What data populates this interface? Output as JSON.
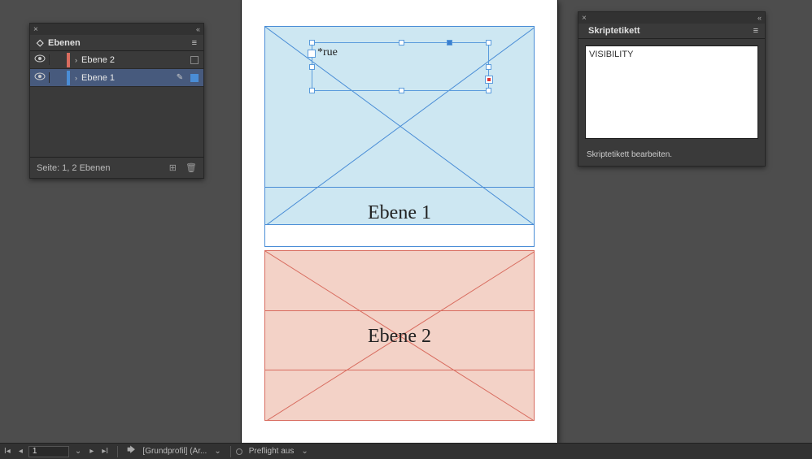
{
  "layers_panel": {
    "title": "Ebenen",
    "rows": [
      {
        "name": "Ebene 2",
        "color": "#d86c5f",
        "selected": false,
        "active_sel": false,
        "pen": false
      },
      {
        "name": "Ebene 1",
        "color": "#4a8dd6",
        "selected": true,
        "active_sel": true,
        "pen": true
      }
    ],
    "footer_text": "Seite: 1, 2 Ebenen"
  },
  "script_panel": {
    "title": "Skriptetikett",
    "value": "VISIBILITY",
    "footer_text": "Skriptetikett bearbeiten."
  },
  "document": {
    "frame1_label": "Ebene 1",
    "frame2_label": "Ebene 2",
    "selected_text": "*rue"
  },
  "statusbar": {
    "page": "1",
    "profile": "[Grundprofil] (Ar...",
    "preflight": "Preflight aus"
  }
}
